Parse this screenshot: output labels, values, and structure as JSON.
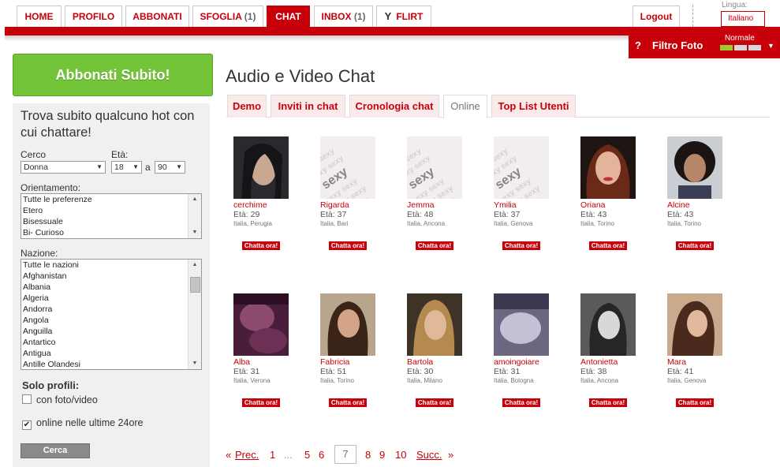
{
  "nav": {
    "tabs": [
      {
        "label": "HOME",
        "count": ""
      },
      {
        "label": "PROFILO",
        "count": ""
      },
      {
        "label": "ABBONATI",
        "count": ""
      },
      {
        "label": "SFOGLIA",
        "count": "(1)"
      },
      {
        "label": "CHAT",
        "count": ""
      },
      {
        "label": "INBOX",
        "count": "(1)"
      },
      {
        "label": "FLIRT",
        "count": ""
      }
    ],
    "active": "CHAT",
    "logout": "Logout",
    "lang_label": "Lingua:",
    "lang_value": "Italiano"
  },
  "filter": {
    "help": "?",
    "title": "Filtro Foto",
    "level": "Normale",
    "level_fraction": 0.33
  },
  "sidebar": {
    "subscribe": "Abbonati Subito!",
    "heading": "Trova subito qualcuno hot con cui chattare!",
    "cerco_label": "Cerco",
    "cerco_value": "Donna",
    "eta_label": "Età:",
    "eta_from": "18",
    "eta_sep": "a",
    "eta_to": "90",
    "orient_label": "Orientamento:",
    "orient_options": [
      "Tutte le preferenze",
      "Etero",
      "Bisessuale",
      "Bi- Curioso"
    ],
    "nazione_label": "Nazione:",
    "nazione_options": [
      "Tutte le nazioni",
      "Afghanistan",
      "Albania",
      "Algeria",
      "Andorra",
      "Angola",
      "Anguilla",
      "Antartico",
      "Antigua",
      "Antille Olandesi"
    ],
    "solo_label": "Solo profili:",
    "check_photo": "con foto/video",
    "check_photo_checked": false,
    "check_online": "online nelle ultime 24ore",
    "check_online_checked": true,
    "search_button": "Cerca"
  },
  "main": {
    "title": "Audio e Video Chat",
    "tabs": [
      "Demo",
      "Inviti in chat",
      "Cronologia chat",
      "Online",
      "Top List Utenti"
    ],
    "active_tab": "Online",
    "chat_button": "Chatta ora!",
    "age_prefix": "Età:",
    "profiles": [
      {
        "name": "cerchime",
        "age": "29",
        "location": "Italia, Perugia",
        "photo": "dark-hair-woman"
      },
      {
        "name": "Rigarda",
        "age": "37",
        "location": "Italia, Bari",
        "photo": "sexy-placeholder"
      },
      {
        "name": "Jemma",
        "age": "48",
        "location": "Italia, Ancona",
        "photo": "sexy-placeholder"
      },
      {
        "name": "Ymilia",
        "age": "37",
        "location": "Italia, Genova",
        "photo": "sexy-placeholder"
      },
      {
        "name": "Oriana",
        "age": "43",
        "location": "Italia, Torino",
        "photo": "red-hair-woman"
      },
      {
        "name": "Alcine",
        "age": "43",
        "location": "Italia, Torino",
        "photo": "curly-hair-woman"
      },
      {
        "name": "Alba",
        "age": "31",
        "location": "Italia, Verona",
        "photo": "purple-photo"
      },
      {
        "name": "Fabricia",
        "age": "51",
        "location": "Italia, Torino",
        "photo": "brunette-woman"
      },
      {
        "name": "Bartola",
        "age": "30",
        "location": "Italia, Milano",
        "photo": "blonde-woman"
      },
      {
        "name": "amoingoiare",
        "age": "31",
        "location": "Italia, Bologna",
        "photo": "dim-photo"
      },
      {
        "name": "Antonietta",
        "age": "38",
        "location": "Italia, Ancona",
        "photo": "bw-photo"
      },
      {
        "name": "Mara",
        "age": "41",
        "location": "Italia, Genova",
        "photo": "long-hair-woman"
      }
    ]
  },
  "pagination": {
    "prev_arrow": "«",
    "prev": "Prec.",
    "pages_before": [
      "1",
      "...",
      "5",
      "6"
    ],
    "current": "7",
    "pages_after": [
      "8",
      "9",
      "10"
    ],
    "next": "Succ.",
    "next_arrow": "»"
  }
}
